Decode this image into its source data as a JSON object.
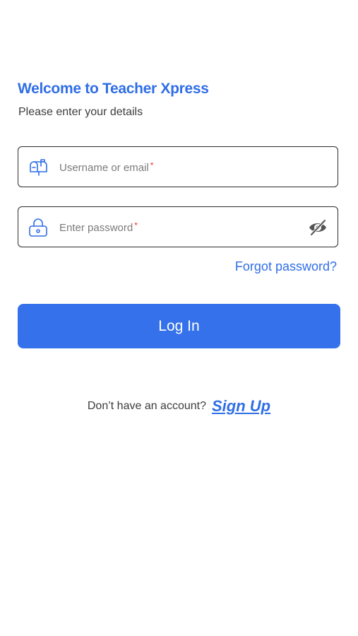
{
  "header": {
    "title": "Welcome to Teacher Xpress",
    "subtitle": "Please enter your details"
  },
  "form": {
    "username": {
      "placeholder": "Username or email",
      "required_mark": "*",
      "value": "",
      "icon": "mailbox-icon"
    },
    "password": {
      "placeholder": "Enter password",
      "required_mark": "*",
      "value": "",
      "icon": "lock-icon",
      "toggle_icon": "eye-off-icon"
    },
    "forgot_label": "Forgot password?",
    "login_label": "Log In"
  },
  "footer": {
    "prompt": "Don’t have an account?",
    "signup_label": "Sign Up"
  },
  "colors": {
    "accent": "#3471ea",
    "link": "#2f6ee6",
    "required": "#e53935",
    "border": "#2b2b2b"
  }
}
